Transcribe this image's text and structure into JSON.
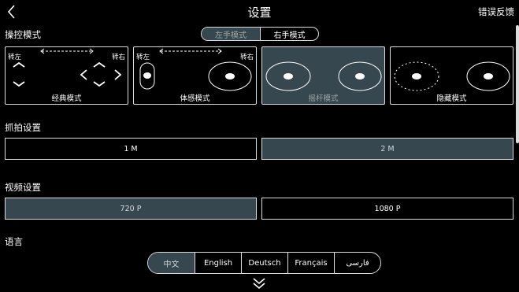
{
  "header": {
    "title": "设置",
    "feedback": "错误反馈",
    "back_icon": "chevron-left-icon"
  },
  "control": {
    "title": "操控模式",
    "hand_options": [
      {
        "label": "左手模式",
        "selected": true
      },
      {
        "label": "右手模式",
        "selected": false
      }
    ],
    "modes": [
      {
        "label": "经典模式",
        "left_hint": "转左",
        "right_hint": "转右",
        "selected": false
      },
      {
        "label": "体感模式",
        "left_hint": "转左",
        "right_hint": "转右",
        "selected": false
      },
      {
        "label": "摇杆模式",
        "left_hint": "",
        "right_hint": "",
        "selected": true
      },
      {
        "label": "隐藏模式",
        "left_hint": "",
        "right_hint": "",
        "selected": false
      }
    ]
  },
  "capture": {
    "title": "抓拍设置",
    "options": [
      {
        "label": "1 M",
        "selected": false
      },
      {
        "label": "2 M",
        "selected": true
      }
    ]
  },
  "video": {
    "title": "视频设置",
    "options": [
      {
        "label": "720 P",
        "selected": true
      },
      {
        "label": "1080 P",
        "selected": false
      }
    ]
  },
  "language": {
    "title": "语言",
    "options": [
      {
        "label": "中文",
        "selected": true
      },
      {
        "label": "English",
        "selected": false
      },
      {
        "label": "Deutsch",
        "selected": false
      },
      {
        "label": "Français",
        "selected": false
      },
      {
        "label": "فارسی",
        "selected": false
      }
    ]
  },
  "colors": {
    "accent": "#37474f",
    "border": "#dddddd",
    "background": "#000000"
  }
}
